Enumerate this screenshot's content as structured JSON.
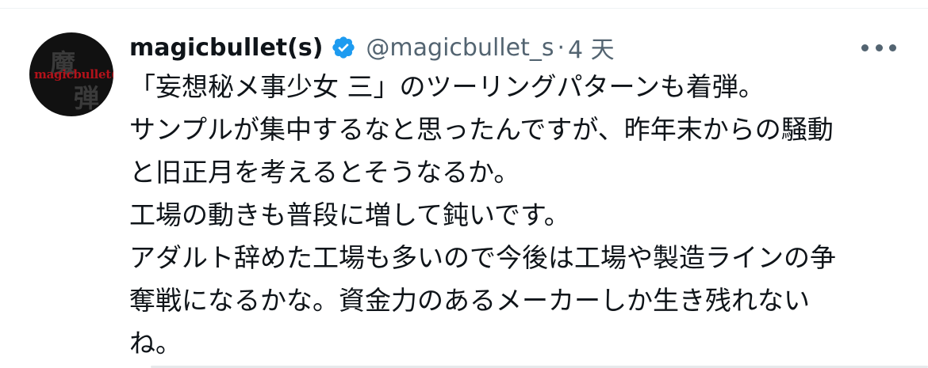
{
  "author": {
    "display_name": "magicbullet(s)",
    "handle": "@magicbullet_s",
    "separator": "·",
    "time": "4 天",
    "verified": true,
    "avatar_logo_text": "magicbullet(s)",
    "avatar_kanji": [
      "魔",
      "弾"
    ]
  },
  "tweet": {
    "lines": [
      "「妄想秘メ事少女 三」のツーリングパターンも着弾。",
      "サンプルが集中するなと思ったんですが、昨年末からの騒動",
      "と旧正月を考えるとそうなるか。",
      "工場の動きも普段に増して鈍いです。",
      "アダルト辞めた工場も多いので今後は工場や製造ラインの争",
      "奪戦になるかな。資金力のあるメーカーしか生き残れない",
      "ね。"
    ]
  },
  "colors": {
    "text": "#0f1419",
    "secondary": "#536471",
    "verified_badge": "#1d9bf0",
    "logo_red": "#b3121a"
  },
  "icons": {
    "verified": "verified-badge-icon",
    "more": "more-options-icon"
  }
}
